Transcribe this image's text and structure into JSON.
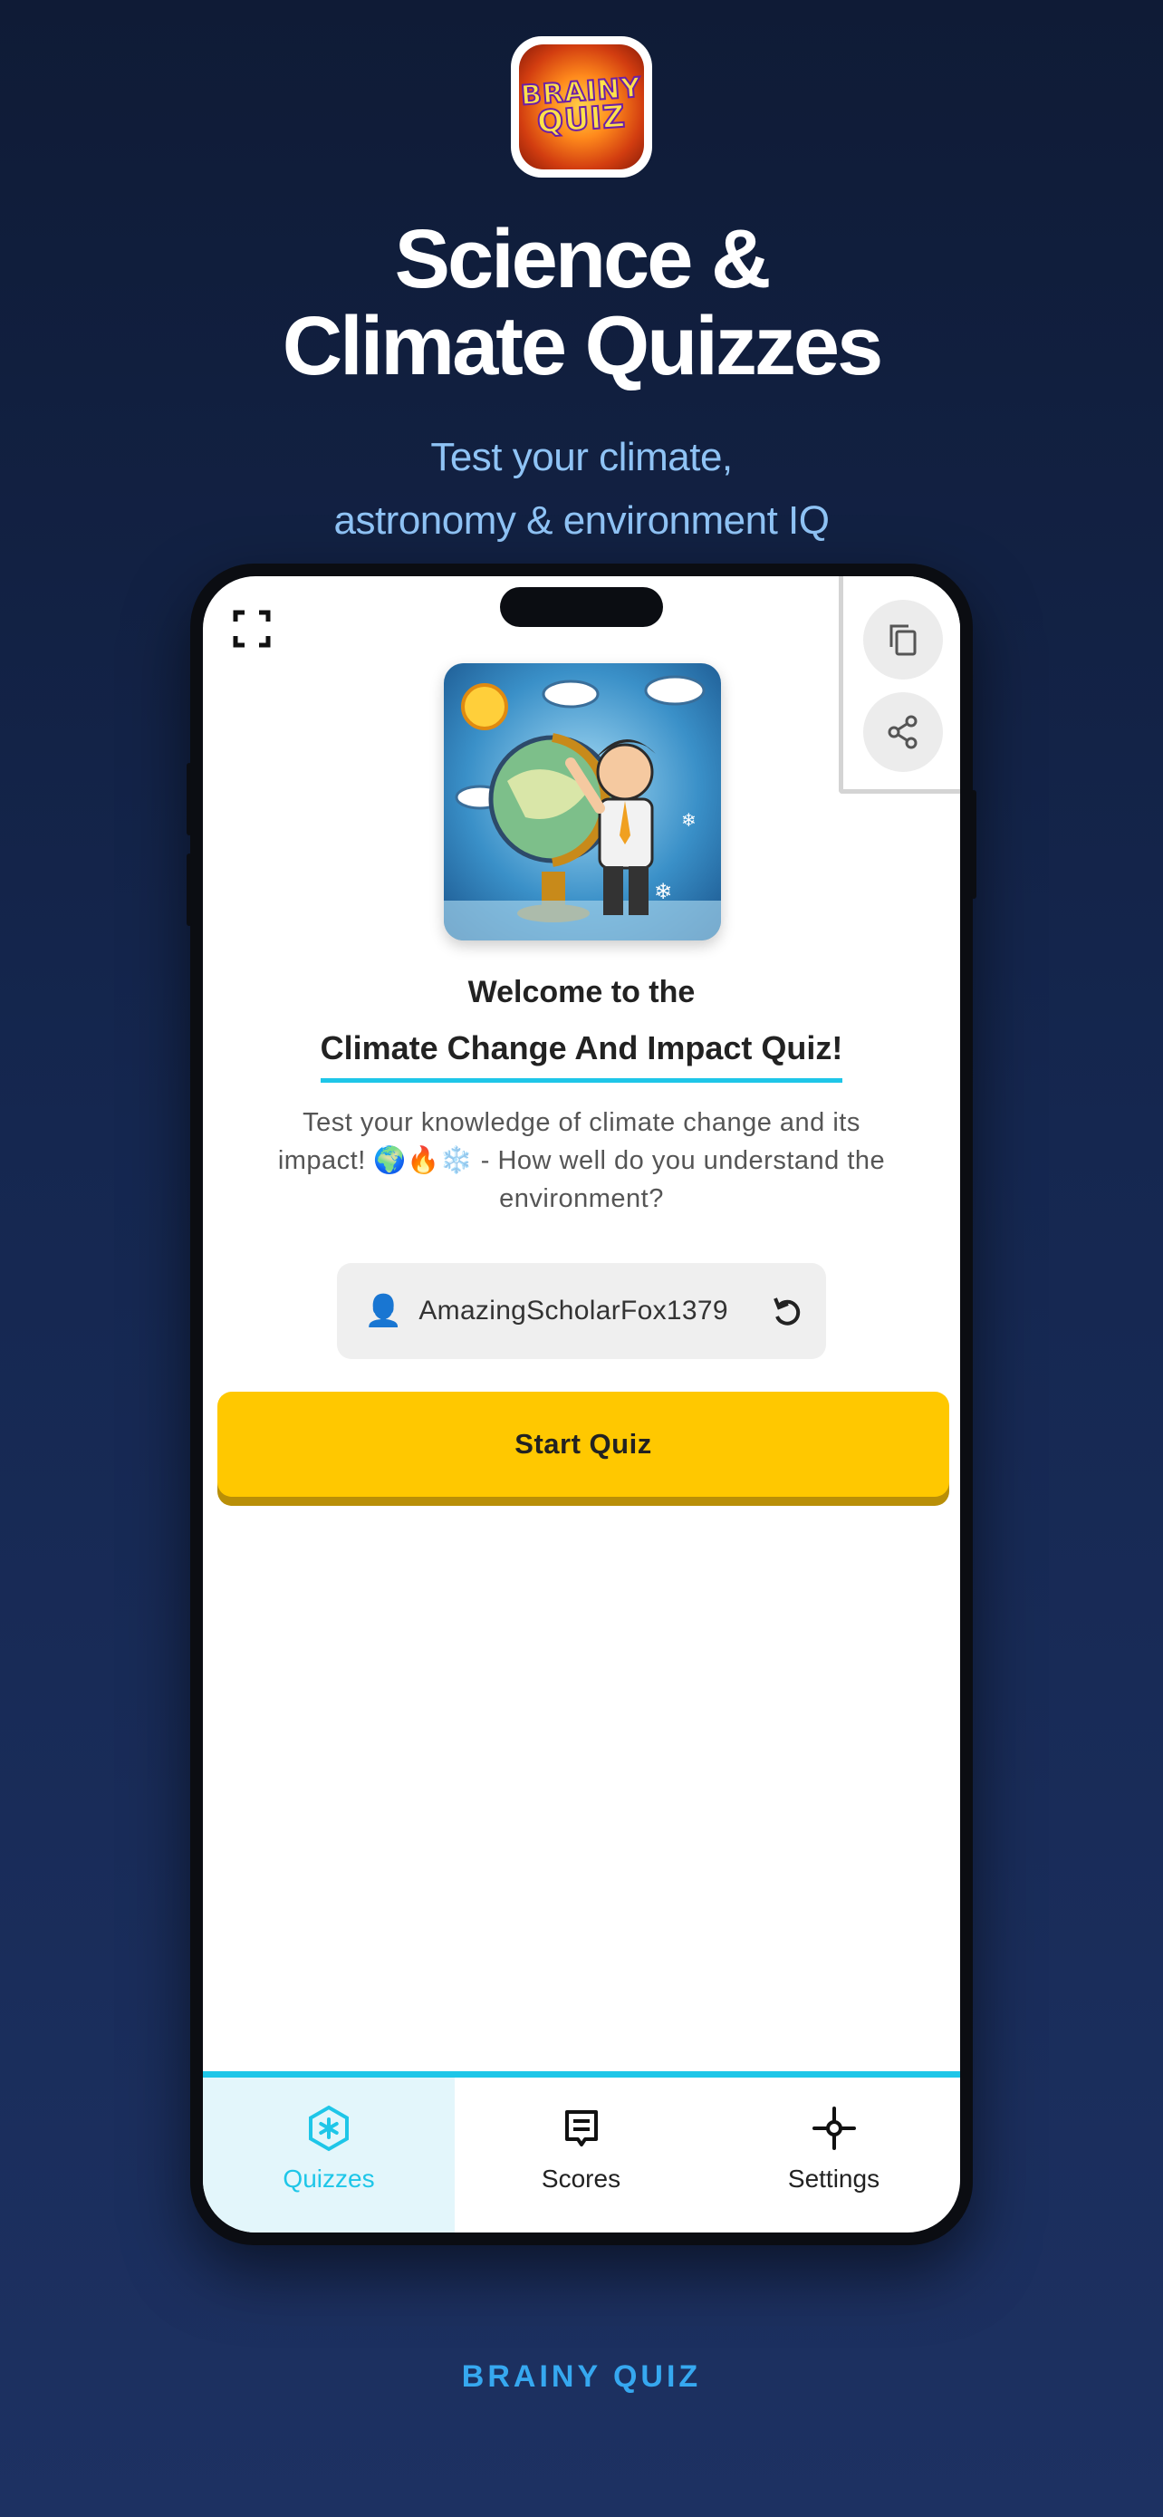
{
  "app_icon": {
    "line1": "BRAINY",
    "line2": "QUIZ"
  },
  "headline": {
    "line1": "Science &",
    "line2": "Climate Quizzes"
  },
  "subline": {
    "line1": "Test your climate,",
    "line2": "astronomy & environment IQ"
  },
  "quiz": {
    "welcome": "Welcome to the",
    "title": "Climate Change And Impact Quiz!",
    "description": "Test your knowledge of climate change and its impact! 🌍🔥❄️ - How well do you understand the environment?",
    "username": "AmazingScholarFox1379",
    "start_label": "Start Quiz"
  },
  "tabs": [
    {
      "label": "Quizzes",
      "icon": "quizzes-icon"
    },
    {
      "label": "Scores",
      "icon": "scores-icon"
    },
    {
      "label": "Settings",
      "icon": "settings-icon"
    }
  ],
  "footer": {
    "brand": "BRAINY QUIZ"
  },
  "colors": {
    "accent": "#1ec6e8",
    "button": "#ffc800",
    "brand_text": "#36a8f0",
    "subline": "#8fc3f5"
  }
}
